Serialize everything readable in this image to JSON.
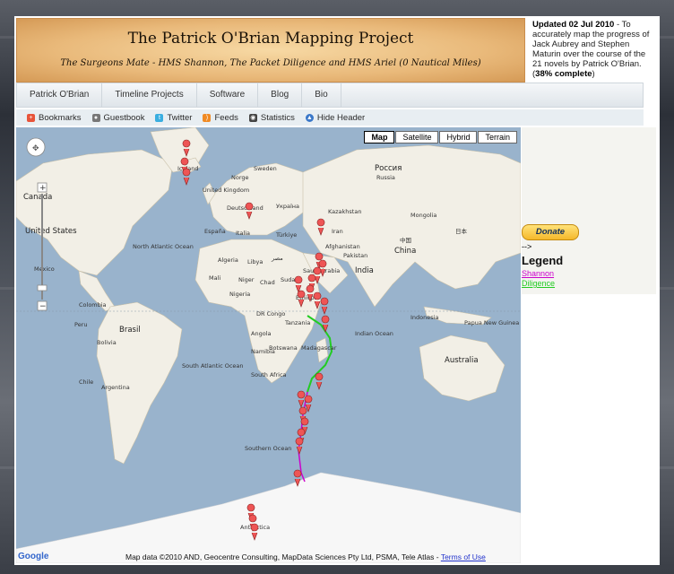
{
  "banner": {
    "title": "The Patrick O'Brian Mapping Project",
    "subtitle": "The Surgeons Mate - HMS Shannon, The Packet Diligence and HMS Ariel (0 Nautical Miles)"
  },
  "update": {
    "date_label": "Updated 02 Jul 2010",
    "text": " - To accurately map the progress of Jack Aubrey and Stephen Maturin over the course of the 21 novels by Patrick O'Brian. (",
    "percent": "38% complete",
    "close": ")"
  },
  "nav": {
    "items": [
      {
        "label": "Patrick O'Brian"
      },
      {
        "label": "Timeline Projects"
      },
      {
        "label": "Software"
      },
      {
        "label": "Blog"
      },
      {
        "label": "Bio"
      }
    ]
  },
  "links": {
    "items": [
      {
        "label": "Bookmarks",
        "icon": "plus-icon",
        "color": "#e8543a"
      },
      {
        "label": "Guestbook",
        "icon": "user-icon",
        "color": "#666666"
      },
      {
        "label": "Twitter",
        "icon": "twitter-icon",
        "color": "#3aaee0"
      },
      {
        "label": "Feeds",
        "icon": "rss-icon",
        "color": "#f08a24"
      },
      {
        "label": "Statistics",
        "icon": "stats-icon",
        "color": "#444444"
      },
      {
        "label": "Hide Header",
        "icon": "up-arrow-icon",
        "color": "#3b78c9"
      }
    ]
  },
  "map": {
    "types": [
      "Map",
      "Satellite",
      "Hybrid",
      "Terrain"
    ],
    "selected": "Map",
    "attribution": "Map data ©2010 AND, Geocentre Consulting, MapData Sciences Pty Ltd, PSMA, Tele Atlas - ",
    "terms": "Terms of Use",
    "provider": "Google",
    "labels": {
      "canada": "Canada",
      "united_states": "United States",
      "mexico": "Mexico",
      "north_atlantic": "North Atlantic Ocean",
      "brasil": "Brasil",
      "bolivia": "Bolivia",
      "peru": "Peru",
      "colombia": "Colombia",
      "argentina": "Argentina",
      "chile": "Chile",
      "south_atlantic": "South Atlantic Ocean",
      "iceland": "Iceland",
      "norge": "Norge",
      "sverige": "Sweden",
      "uk": "United Kingdom",
      "espana": "España",
      "italia": "Italia",
      "germany": "Deutschland",
      "ukraine": "Україна",
      "turkiye": "Türkiye",
      "algeria": "Algeria",
      "libya": "Libya",
      "egypt": "مصر",
      "mali": "Mali",
      "niger": "Niger",
      "chad": "Chad",
      "sudan": "Sudan",
      "nigeria": "Nigeria",
      "ethiopia": "Ethiopia",
      "dr_congo": "DR Congo",
      "tanzania": "Tanzania",
      "angola": "Angola",
      "namibia": "Namibia",
      "botswana": "Botswana",
      "south_africa": "South Africa",
      "madagascar": "Madagascar",
      "saudi": "Saudi Arabia",
      "iran": "Iran",
      "afghanistan": "Afghanistan",
      "pakistan": "Pakistan",
      "india": "India",
      "kazakhstan": "Kazakhstan",
      "russia": "Россия",
      "russia_en": "Russia",
      "mongolia": "Mongolia",
      "china_cn": "中国",
      "china": "China",
      "japan": "日本",
      "indian_ocean": "Indian Ocean",
      "indonesia": "Indonesia",
      "png": "Papua New Guinea",
      "australia": "Australia",
      "southern_ocean": "Southern Ocean",
      "antarctica": "Antarctica"
    }
  },
  "side": {
    "donate": "Donate",
    "arrow": "-->",
    "legend": "Legend",
    "legend_items": [
      {
        "label": "Shannon",
        "color": "#cc00cc"
      },
      {
        "label": "Diligence",
        "color": "#22cc22"
      }
    ]
  }
}
